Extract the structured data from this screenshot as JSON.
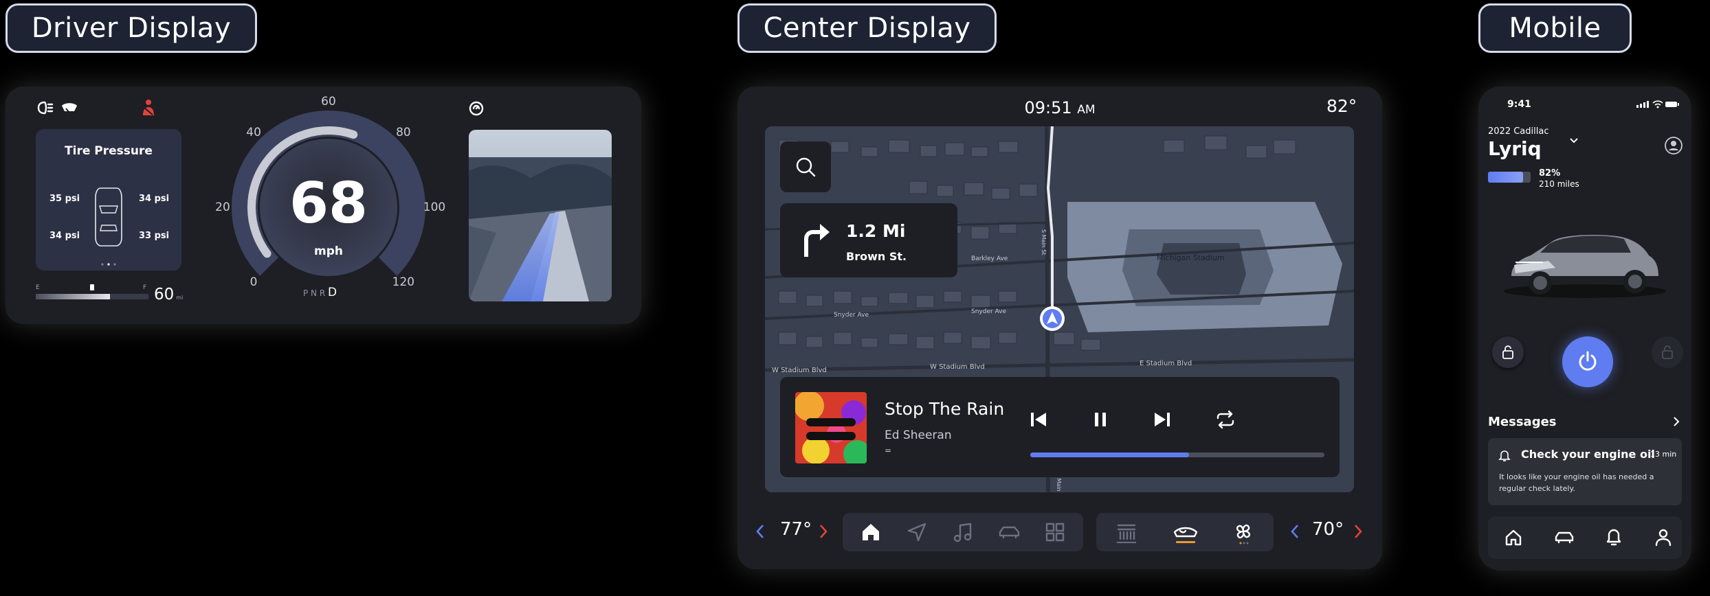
{
  "section_labels": {
    "driver": "Driver Display",
    "center": "Center Display",
    "mobile": "Mobile"
  },
  "driver": {
    "tire": {
      "title": "Tire Pressure",
      "front_left": "35 psi",
      "front_right": "34 psi",
      "rear_left": "34 psi",
      "rear_right": "33 psi"
    },
    "fuel": {
      "empty_label": "E",
      "full_label": "F",
      "range_value": "60",
      "range_unit": "mi",
      "level": 0.66
    },
    "speed": {
      "value": "68",
      "unit": "mph",
      "ticks": [
        "0",
        "20",
        "40",
        "60",
        "80",
        "100",
        "120"
      ],
      "gears": "P N R",
      "active_gear": "D",
      "fraction": 0.57
    },
    "icons": [
      "headlight-icon",
      "wiper-icon",
      "seatbelt-icon",
      "lane-assist-icon"
    ]
  },
  "center": {
    "time": "09:51",
    "ampm": "AM",
    "outside_temp": "82°",
    "nav": {
      "distance": "1.2 Mi",
      "street": "Brown St."
    },
    "map_labels": {
      "stadium": "Michigan Stadium",
      "barkley": "Barkley Ave",
      "snyder1": "Snyder Ave",
      "snyder2": "Snyder Ave",
      "stadium_blvd_w": "W Stadium Blvd",
      "stadium_blvd_w2": "W Stadium Blvd",
      "stadium_blvd_e": "E Stadium Blvd",
      "main": "S Main St",
      "main2": "S Main St"
    },
    "media": {
      "title": "Stop The Rain",
      "artist": "Ed Sheeran",
      "album_glyph": "=",
      "progress": 0.54
    },
    "climate": {
      "left_temp": "77°",
      "right_temp": "70°"
    },
    "dock": [
      "home-icon",
      "navigation-icon",
      "music-icon",
      "car-icon",
      "apps-icon"
    ],
    "climate_icons": [
      "defrost-icon",
      "car-airflow-icon",
      "fan-icon"
    ]
  },
  "mobile": {
    "status_time": "9:41",
    "year_make": "2022 Cadillac",
    "model": "Lyriq",
    "battery_percent": "82%",
    "battery_range": "210 miles",
    "battery_level": 0.82,
    "messages_title": "Messages",
    "message": {
      "title": "Check your engine oil",
      "time": "13 min",
      "body": "It looks like your engine oil has needed a regular check lately."
    },
    "tabbar": [
      "home-icon",
      "car-icon",
      "bell-icon",
      "profile-icon"
    ],
    "accent": "#5f7df0"
  }
}
